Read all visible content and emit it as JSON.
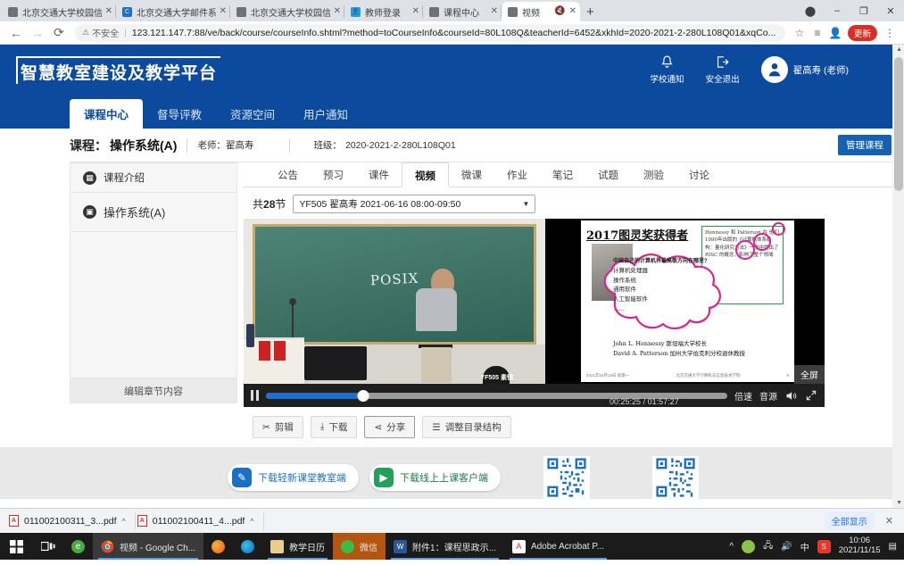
{
  "browser": {
    "tabs": [
      {
        "title": "北京交通大学校园信息门",
        "favicon": "globe-icon",
        "active": false
      },
      {
        "title": "北京交通大学邮件系统",
        "favicon": "mail-c-icon",
        "active": false
      },
      {
        "title": "北京交通大学校园信息门",
        "favicon": "globe-icon",
        "active": false
      },
      {
        "title": "教师登录",
        "favicon": "teacher-icon",
        "active": false
      },
      {
        "title": "课程中心",
        "favicon": "globe-icon",
        "active": false
      },
      {
        "title": "视频",
        "favicon": "globe-icon",
        "active": true
      }
    ],
    "new_tab_label": "+",
    "window_controls": {
      "profile": "profile-icon",
      "minimize": "–",
      "maximize": "❐",
      "close": "✕"
    },
    "omnibox": {
      "back": "←",
      "forward": "→",
      "reload": "⟳",
      "security_label": "不安全",
      "url": "123.121.147.7:88/ve/back/course/courseInfo.shtml?method=toCourseInfo&courseId=80L108Q&teacherId=6452&xkhId=2020-2021-2-280L108Q01&xqCo...",
      "star": "☆",
      "collections": "≡",
      "avatar": "account-icon",
      "update_label": "更新",
      "menu": "⋮"
    }
  },
  "site": {
    "brand": "智慧教室建设及教学平台",
    "header_actions": [
      {
        "label": "学校通知",
        "icon": "bell-icon"
      },
      {
        "label": "安全退出",
        "icon": "logout-icon"
      }
    ],
    "user": {
      "name": "翟高寿 (老师)",
      "avatar": "user-avatar-icon"
    },
    "nav_tabs": [
      {
        "label": "课程中心",
        "active": true
      },
      {
        "label": "督导评教",
        "active": false
      },
      {
        "label": "资源空间",
        "active": false
      },
      {
        "label": "用户通知",
        "active": false
      }
    ]
  },
  "course_bar": {
    "course_label": "课程：",
    "course_name": "操作系统(A)",
    "teacher_label": "老师：",
    "teacher_name": "翟高寿",
    "class_label": "班级：",
    "class_value": "2020-2021-2-280L108Q01",
    "manage_button": "管理课程"
  },
  "sidebar": {
    "items": [
      {
        "label": "课程介绍",
        "icon": "chart-icon"
      },
      {
        "label": "操作系统(A)",
        "icon": "book-icon"
      }
    ],
    "edit_button": "编辑章节内容"
  },
  "content_tabs": [
    {
      "label": "公告",
      "active": false
    },
    {
      "label": "预习",
      "active": false
    },
    {
      "label": "课件",
      "active": false
    },
    {
      "label": "视频",
      "active": true
    },
    {
      "label": "微课",
      "active": false
    },
    {
      "label": "作业",
      "active": false
    },
    {
      "label": "笔记",
      "active": false
    },
    {
      "label": "试题",
      "active": false
    },
    {
      "label": "测验",
      "active": false
    },
    {
      "label": "讨论",
      "active": false
    }
  ],
  "video_panel": {
    "count_prefix": "共",
    "count_number": "28",
    "count_suffix": "节",
    "session_select": "YF505 翟高寿 2021-06-16 08:00-09:50",
    "fullscreen_tag": "全屏",
    "board_text": "POSIX",
    "camera_watermark": "YF505 素锈",
    "slide": {
      "title": "2017图灵奖获得者",
      "question": "中国自己的计算机界最高敬方向在哪里?",
      "cloud_items": [
        "计算机处理器",
        "操作系统",
        "通用软件",
        "人工智能软件",
        "……"
      ],
      "greenbox_text": "Hennessy 和 Patterson 在 他们1990年出版的《计算机体系结构：量化研究方法》一书中提出了 RISC 的概念，影响了整个领域",
      "list_items": [
        "John L. Hennessy  斯坦福大学校长",
        "David A. Patterson  加州大学伯克利分校退休教授"
      ],
      "footer_left": "2021年04月18日 星期一",
      "footer_center": "北京交通大学计算机与信息技术学院",
      "footer_right": "8"
    },
    "controls": {
      "pause": "pause-icon",
      "progress_percent": 21,
      "current_time": "00:25:25",
      "total_time": "01:57:27",
      "time_separator": "/",
      "speed_label": "倍速",
      "audio_label": "音源",
      "volume": "volume-icon",
      "expand": "expand-icon"
    },
    "actions": [
      {
        "label": "剪辑",
        "icon": "scissors-icon"
      },
      {
        "label": "下载",
        "icon": "download-icon"
      },
      {
        "label": "分享",
        "icon": "share-icon"
      },
      {
        "label": "调整目录结构",
        "icon": "list-icon"
      }
    ]
  },
  "footer_strip": {
    "downloads": [
      {
        "label": "下载轻新课堂教室端",
        "icon": "classroom-app-icon"
      },
      {
        "label": "下载线上上课客户端",
        "icon": "online-class-icon"
      }
    ]
  },
  "download_shelf": {
    "files": [
      {
        "name": "011002100311_3...pdf",
        "icon": "pdf-icon",
        "menu": "^"
      },
      {
        "name": "011002100411_4...pdf",
        "icon": "pdf-icon",
        "menu": "^"
      }
    ],
    "show_all": "全部显示",
    "close": "✕"
  },
  "taskbar": {
    "start": "windows-icon",
    "taskview": "task-view-icon",
    "items": [
      {
        "label": "",
        "icon": "green-app-icon",
        "state": "idle"
      },
      {
        "label": "视频 - Google Ch...",
        "icon": "chrome-icon",
        "state": "active"
      },
      {
        "label": "",
        "icon": "firefox-icon",
        "state": "idle"
      },
      {
        "label": "",
        "icon": "edge-icon",
        "state": "idle"
      },
      {
        "label": "教学日历",
        "icon": "calendar-icon",
        "state": "open"
      },
      {
        "label": "微信",
        "icon": "wechat-icon",
        "state": "active-highlight"
      },
      {
        "label": "附件1：课程思政示...",
        "icon": "word-icon",
        "state": "open"
      },
      {
        "label": "Adobe Acrobat P...",
        "icon": "acrobat-icon",
        "state": "open"
      }
    ],
    "tray": {
      "chevron": "^",
      "icons": [
        "update-icon",
        "network-icon",
        "volume-icon",
        "ime-cn-icon",
        "sogou-icon"
      ],
      "time": "10:06",
      "date": "2021/11/15",
      "notification": "notification-icon"
    }
  }
}
